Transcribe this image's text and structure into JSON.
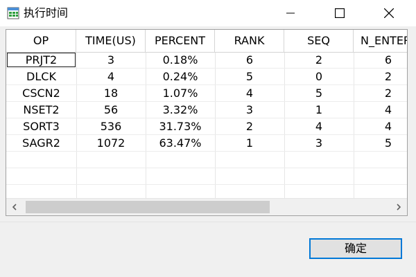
{
  "window": {
    "title": "执行时间",
    "icon": "grid-table-icon"
  },
  "table": {
    "columns": [
      "OP",
      "TIME(US)",
      "PERCENT",
      "RANK",
      "SEQ",
      "N_ENTER"
    ],
    "rows": [
      [
        "PRJT2",
        "3",
        "0.18%",
        "6",
        "2",
        "6"
      ],
      [
        "DLCK",
        "4",
        "0.24%",
        "5",
        "0",
        "2"
      ],
      [
        "CSCN2",
        "18",
        "1.07%",
        "4",
        "5",
        "2"
      ],
      [
        "NSET2",
        "56",
        "3.32%",
        "3",
        "1",
        "4"
      ],
      [
        "SORT3",
        "536",
        "31.73%",
        "2",
        "4",
        "4"
      ],
      [
        "SAGR2",
        "1072",
        "63.47%",
        "1",
        "3",
        "5"
      ]
    ],
    "focused_cell": "PRJT2"
  },
  "buttons": {
    "ok_label": "确定"
  },
  "colors": {
    "accent": "#0078d7",
    "icon_green": "#2e9e3e"
  }
}
